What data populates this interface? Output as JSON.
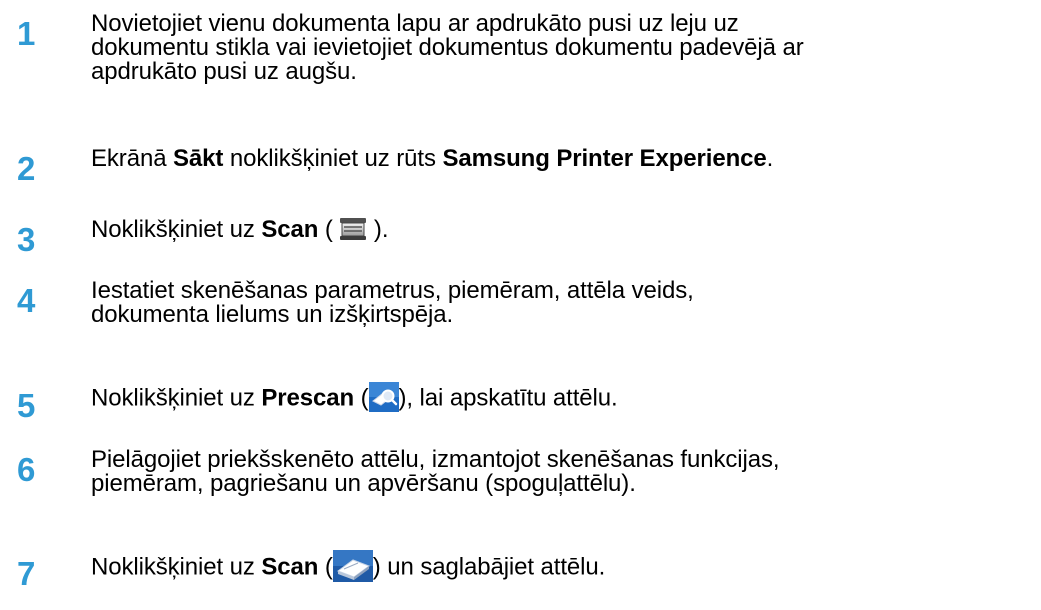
{
  "steps": [
    {
      "number": "1",
      "lines": [
        "Novietojiet vienu dokumenta lapu ar apdrukāto pusi uz leju uz",
        "dokumentu stikla vai ievietojiet dokumentus dokumentu padevējā ar",
        "apdrukāto pusi uz augšu."
      ]
    },
    {
      "number": "2",
      "pre": "Ekrānā ",
      "bold1": "Sākt",
      "mid": " noklikšķiniet uz rūts ",
      "bold2": "Samsung Printer Experience",
      "post": "."
    },
    {
      "number": "3",
      "pre": "Noklikšķiniet uz ",
      "bold": "Scan",
      "open": " ( ",
      "icon": "flatbed-scanner-icon",
      "close": " )."
    },
    {
      "number": "4",
      "lines": [
        "Iestatiet skenēšanas parametrus, piemēram, attēla veids,",
        "dokumenta lielums un izšķirtspēja."
      ]
    },
    {
      "number": "5",
      "pre": "Noklikšķiniet uz ",
      "bold": "Prescan",
      "open": " (",
      "icon": "prescan-magnifier-icon",
      "close": "), lai apskatītu attēlu."
    },
    {
      "number": "6",
      "lines": [
        "Pielāgojiet priekšskenēto attēlu, izmantojot skenēšanas funkcijas,",
        "piemēram, pagriešanu un apvēršanu (spoguļattēlu)."
      ]
    },
    {
      "number": "7",
      "pre": "Noklikšķiniet uz ",
      "bold": "Scan",
      "open": " (",
      "icon": "scan-scanner-icon",
      "close": ") un saglabājiet attēlu."
    }
  ],
  "colors": {
    "step_number": "#2f9ad4",
    "icon_blue": "#1f5aa6"
  }
}
